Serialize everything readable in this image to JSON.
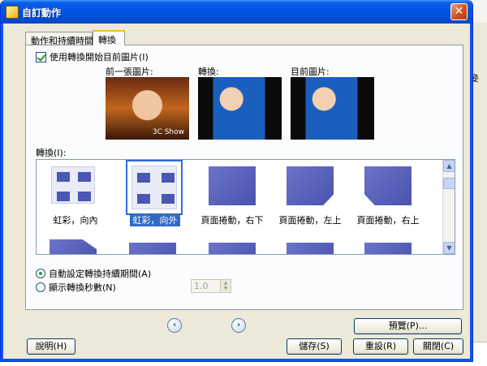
{
  "background": {
    "edge_text": "妾"
  },
  "window": {
    "title": "自訂動作",
    "close_glyph": "✕"
  },
  "tabs": [
    {
      "label": "動作和持續時間"
    },
    {
      "label": "轉換"
    }
  ],
  "use_transition": {
    "label": "使用轉換開始目前圖片(I)",
    "checked": true
  },
  "previews": {
    "previous_label": "前一張圖片:",
    "transition_label": "轉換:",
    "current_label": "目前圖片:",
    "watermark": "3C Show"
  },
  "transitions": {
    "label": "轉換(I):",
    "items": [
      {
        "label": "虹彩，向內",
        "selected": false
      },
      {
        "label": "虹彩，向外",
        "selected": true
      },
      {
        "label": "頁面捲動，右下",
        "selected": false
      },
      {
        "label": "頁面捲動，左上",
        "selected": false
      },
      {
        "label": "頁面捲動，右上",
        "selected": false
      }
    ]
  },
  "duration": {
    "auto_label": "自動設定轉換持續期間(A)",
    "auto_selected": true,
    "manual_label": "顯示轉換秒數(N)",
    "seconds_value": "1.0"
  },
  "nav": {
    "prev_glyph": "‹",
    "next_glyph": "›"
  },
  "buttons": {
    "preview": "預覽(P)...",
    "help": "說明(H)",
    "save": "儲存(S)",
    "reset": "重設(R)",
    "close": "關閉(C)"
  },
  "colors": {
    "titlebar": "#0054e3",
    "selection": "#316ac5",
    "close_button": "#d64f1e"
  }
}
